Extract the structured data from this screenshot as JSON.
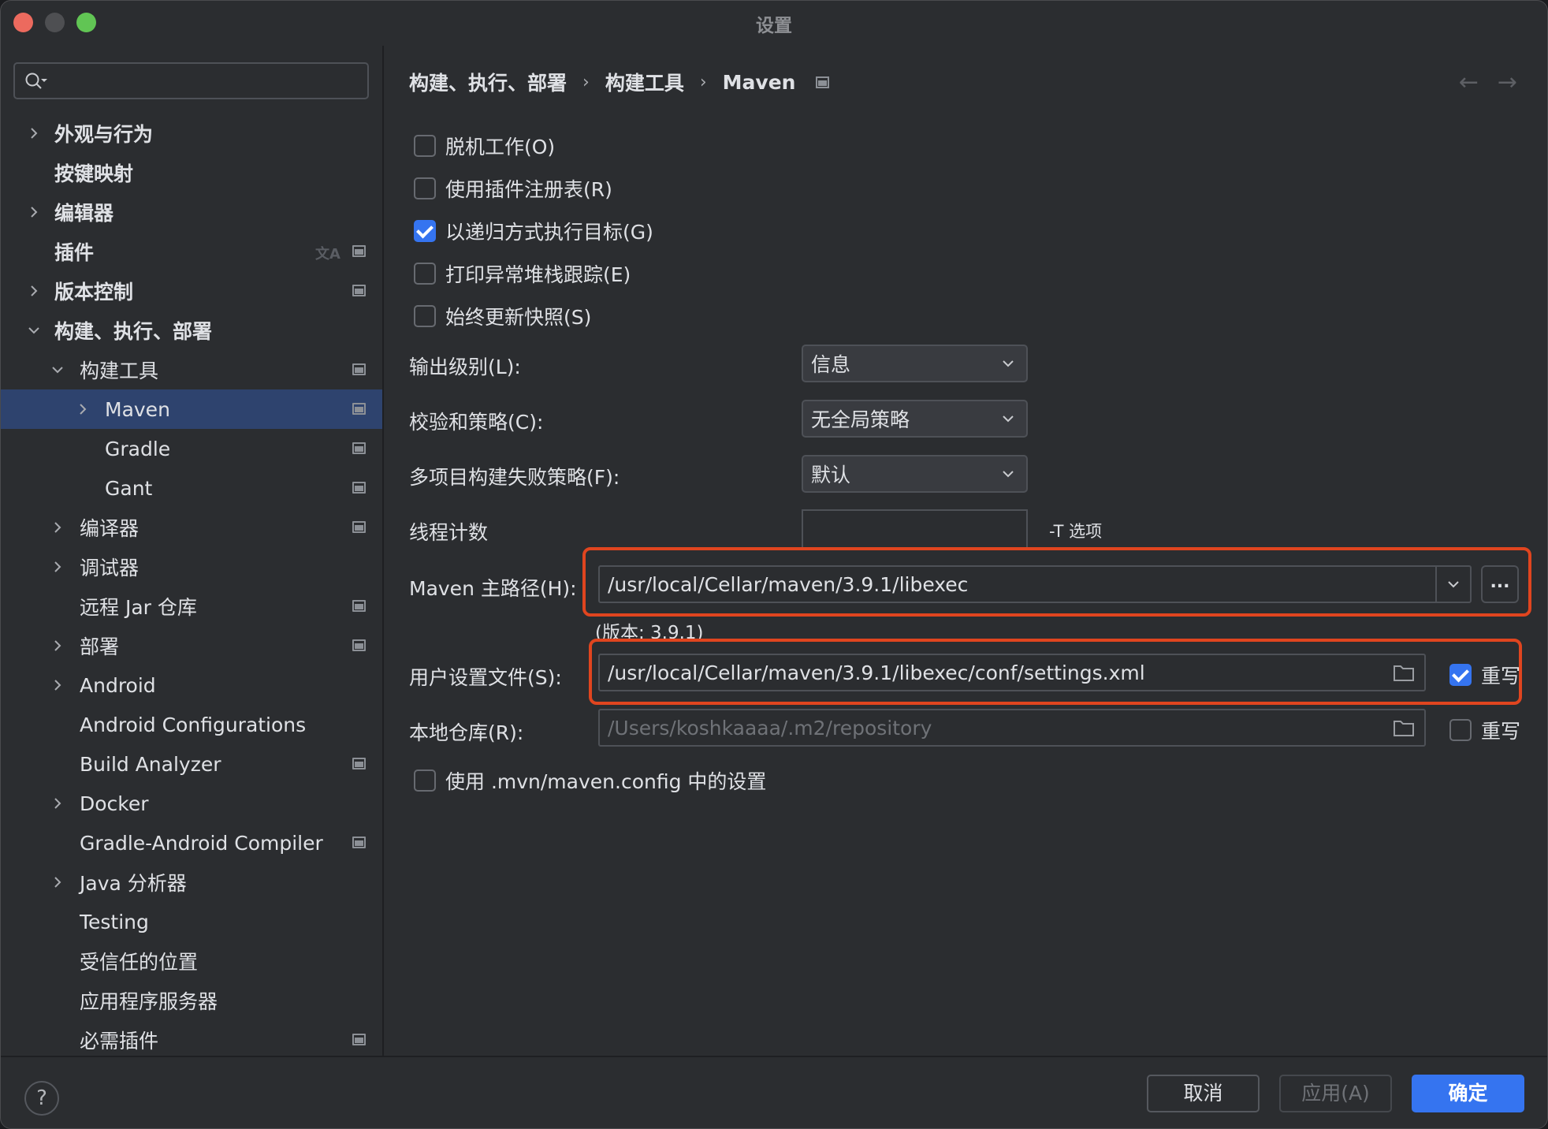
{
  "window": {
    "title": "设置"
  },
  "sidebar": {
    "search_placeholder": "",
    "items": [
      {
        "label": "外观与行为",
        "level": 0,
        "expander": "collapsed",
        "bold": true,
        "project_icon": false
      },
      {
        "label": "按键映射",
        "level": 0,
        "expander": "none",
        "bold": true,
        "project_icon": false
      },
      {
        "label": "编辑器",
        "level": 0,
        "expander": "collapsed",
        "bold": true,
        "project_icon": false
      },
      {
        "label": "插件",
        "level": 0,
        "expander": "none",
        "bold": true,
        "project_icon": true,
        "translate_icon": true
      },
      {
        "label": "版本控制",
        "level": 0,
        "expander": "collapsed",
        "bold": true,
        "project_icon": true
      },
      {
        "label": "构建、执行、部署",
        "level": 0,
        "expander": "expanded",
        "bold": true,
        "project_icon": false
      },
      {
        "label": "构建工具",
        "level": 1,
        "expander": "expanded",
        "bold": false,
        "project_icon": true
      },
      {
        "label": "Maven",
        "level": 2,
        "expander": "collapsed",
        "bold": false,
        "project_icon": true,
        "selected": true
      },
      {
        "label": "Gradle",
        "level": 2,
        "expander": "none",
        "bold": false,
        "project_icon": true
      },
      {
        "label": "Gant",
        "level": 2,
        "expander": "none",
        "bold": false,
        "project_icon": true
      },
      {
        "label": "编译器",
        "level": 1,
        "expander": "collapsed",
        "bold": false,
        "project_icon": true
      },
      {
        "label": "调试器",
        "level": 1,
        "expander": "collapsed",
        "bold": false,
        "project_icon": false
      },
      {
        "label": "远程 Jar 仓库",
        "level": 1,
        "expander": "none",
        "bold": false,
        "project_icon": true
      },
      {
        "label": "部署",
        "level": 1,
        "expander": "collapsed",
        "bold": false,
        "project_icon": true
      },
      {
        "label": "Android",
        "level": 1,
        "expander": "collapsed",
        "bold": false,
        "project_icon": false
      },
      {
        "label": "Android Configurations",
        "level": 1,
        "expander": "none",
        "bold": false,
        "project_icon": false
      },
      {
        "label": "Build Analyzer",
        "level": 1,
        "expander": "none",
        "bold": false,
        "project_icon": true
      },
      {
        "label": "Docker",
        "level": 1,
        "expander": "collapsed",
        "bold": false,
        "project_icon": false
      },
      {
        "label": "Gradle-Android Compiler",
        "level": 1,
        "expander": "none",
        "bold": false,
        "project_icon": true
      },
      {
        "label": "Java 分析器",
        "level": 1,
        "expander": "collapsed",
        "bold": false,
        "project_icon": false
      },
      {
        "label": "Testing",
        "level": 1,
        "expander": "none",
        "bold": false,
        "project_icon": false
      },
      {
        "label": "受信任的位置",
        "level": 1,
        "expander": "none",
        "bold": false,
        "project_icon": false
      },
      {
        "label": "应用程序服务器",
        "level": 1,
        "expander": "none",
        "bold": false,
        "project_icon": false
      },
      {
        "label": "必需插件",
        "level": 1,
        "expander": "none",
        "bold": false,
        "project_icon": true
      }
    ]
  },
  "main": {
    "breadcrumb": [
      "构建、执行、部署",
      "构建工具",
      "Maven"
    ],
    "nav": {
      "back": "←",
      "forward": "→"
    },
    "checkboxes": [
      {
        "label": "脱机工作(O)",
        "checked": false
      },
      {
        "label": "使用插件注册表(R)",
        "checked": false
      },
      {
        "label": "以递归方式执行目标(G)",
        "checked": true
      },
      {
        "label": "打印异常堆栈跟踪(E)",
        "checked": false
      },
      {
        "label": "始终更新快照(S)",
        "checked": false
      }
    ],
    "output_level": {
      "label": "输出级别(L):",
      "value": "信息"
    },
    "checksum_policy": {
      "label": "校验和策略(C):",
      "value": "无全局策略"
    },
    "multiproject_fail": {
      "label": "多项目构建失败策略(F):",
      "value": "默认"
    },
    "thread_count": {
      "label": "线程计数",
      "value": "",
      "hint": "-T 选项"
    },
    "maven_home": {
      "label": "Maven 主路径(H):",
      "value": "/usr/local/Cellar/maven/3.9.1/libexec",
      "browse_label": "...",
      "version_text": "(版本: 3.9.1)"
    },
    "user_settings": {
      "label": "用户设置文件(S):",
      "value": "/usr/local/Cellar/maven/3.9.1/libexec/conf/settings.xml",
      "override_label": "重写",
      "override_checked": true
    },
    "local_repo": {
      "label": "本地仓库(R):",
      "value": "/Users/koshkaaaa/.m2/repository",
      "override_label": "重写",
      "override_checked": false
    },
    "use_mvn_config": {
      "label": "使用 .mvn/maven.config 中的设置",
      "checked": false
    }
  },
  "footer": {
    "help_label": "?",
    "cancel_label": "取消",
    "apply_label": "应用(A)",
    "ok_label": "确定"
  },
  "colors": {
    "accent": "#3574f0",
    "selection": "#2e436e",
    "highlight_annotation": "#e0451f",
    "background": "#2b2d30"
  }
}
